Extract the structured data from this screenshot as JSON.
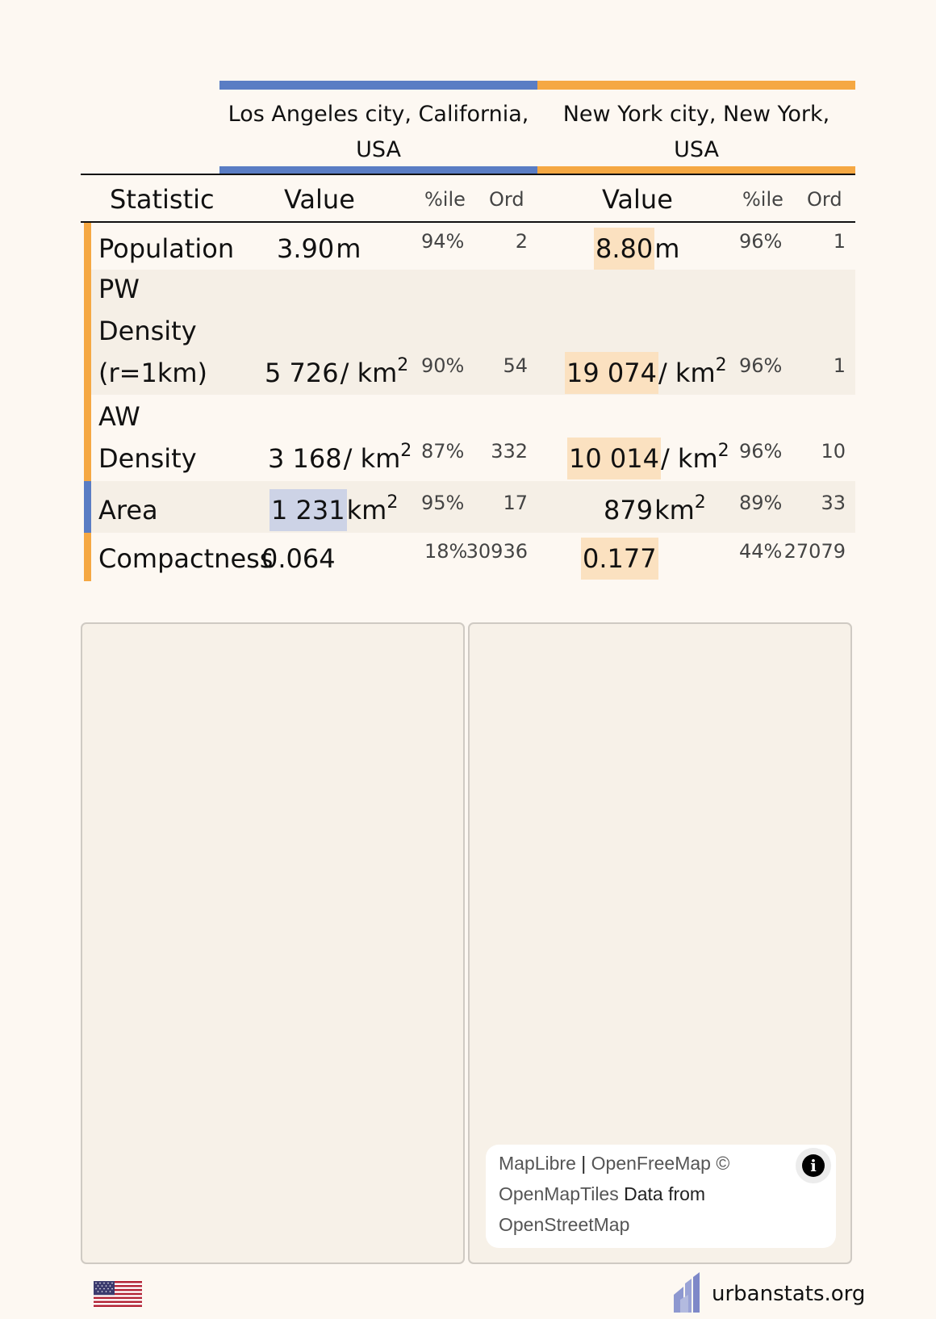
{
  "colors": {
    "blue": "#5a7dc4",
    "orange": "#f5a843"
  },
  "header": {
    "cities": [
      {
        "name": "Los Angeles city, California, USA",
        "line1": "Los Angeles city, California,",
        "line2": "USA"
      },
      {
        "name": "New York city, New York, USA",
        "line1": "New York city, New York,",
        "line2": "USA"
      }
    ],
    "columns": {
      "statistic": "Statistic",
      "value": "Value",
      "percentile": "%ile",
      "ordinal": "Ord"
    }
  },
  "rows": [
    {
      "label_lines": [
        "Population"
      ],
      "la": {
        "value": "3.90",
        "unit": "m",
        "sup": "",
        "pct": "94%",
        "ord": "2"
      },
      "ny": {
        "value": "8.80",
        "unit": "m",
        "sup": "",
        "pct": "96%",
        "ord": "1"
      }
    },
    {
      "label_lines": [
        "PW",
        "Density",
        "(r=1km)"
      ],
      "la": {
        "value": "5 726",
        "unit": "/ km",
        "sup": "2",
        "pct": "90%",
        "ord": "54"
      },
      "ny": {
        "value": "19 074",
        "unit": "/ km",
        "sup": "2",
        "pct": "96%",
        "ord": "1"
      }
    },
    {
      "label_lines": [
        "AW",
        "Density"
      ],
      "la": {
        "value": "3 168",
        "unit": "/ km",
        "sup": "2",
        "pct": "87%",
        "ord": "332"
      },
      "ny": {
        "value": "10 014",
        "unit": "/ km",
        "sup": "2",
        "pct": "96%",
        "ord": "10"
      }
    },
    {
      "label_lines": [
        "Area"
      ],
      "la": {
        "value": "1 231",
        "unit": "km",
        "sup": "2",
        "pct": "95%",
        "ord": "17"
      },
      "ny": {
        "value": "879",
        "unit": "km",
        "sup": "2",
        "pct": "89%",
        "ord": "33"
      }
    },
    {
      "label_lines": [
        "Compactness"
      ],
      "la": {
        "value": "0.064",
        "unit": "",
        "sup": "",
        "pct": "18%",
        "ord": "30936"
      },
      "ny": {
        "value": "0.177",
        "unit": "",
        "sup": "",
        "pct": "44%",
        "ord": "27079"
      }
    }
  ],
  "map": {
    "attribution": {
      "maplibre": "MapLibre",
      "sep": " | ",
      "openfreemap": "OpenFreeMap",
      "copy": " © ",
      "openmaptiles": "OpenMapTiles",
      "data_from": " Data from ",
      "osm": "OpenStreetMap"
    },
    "info_icon": "i"
  },
  "footer": {
    "flag_icon": "us-flag-icon",
    "logo_icon": "urbanstats-logo-icon",
    "site": "urbanstats.org"
  }
}
